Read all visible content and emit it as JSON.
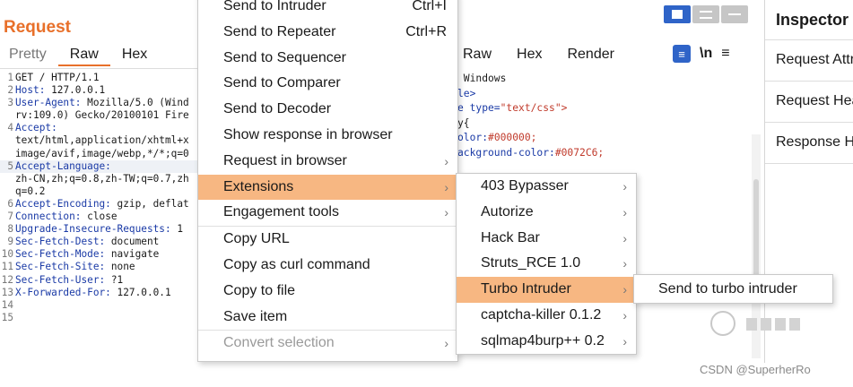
{
  "request": {
    "title": "Request",
    "tabs": [
      "Pretty",
      "Raw",
      "Hex"
    ],
    "lines": [
      {
        "n": "1",
        "key": "",
        "val": "GET / HTTP/1.1"
      },
      {
        "n": "2",
        "key": "Host:",
        "val": " 127.0.0.1"
      },
      {
        "n": "3",
        "key": "User-Agent:",
        "val": " Mozilla/5.0 (Wind"
      },
      {
        "n": "",
        "key": "",
        "val": "rv:109.0) Gecko/20100101 Fire"
      },
      {
        "n": "4",
        "key": "Accept:",
        "val": ""
      },
      {
        "n": "",
        "key": "",
        "val": "text/html,application/xhtml+x"
      },
      {
        "n": "",
        "key": "",
        "val": "image/avif,image/webp,*/*;q=0"
      },
      {
        "n": "5",
        "key": "Accept-Language:",
        "val": ""
      },
      {
        "n": "",
        "key": "",
        "val": "zh-CN,zh;q=0.8,zh-TW;q=0.7,zh"
      },
      {
        "n": "",
        "key": "",
        "val": "q=0.2"
      },
      {
        "n": "6",
        "key": "Accept-Encoding:",
        "val": " gzip, deflat"
      },
      {
        "n": "7",
        "key": "Connection:",
        "val": " close"
      },
      {
        "n": "8",
        "key": "Upgrade-Insecure-Requests:",
        "val": " 1"
      },
      {
        "n": "9",
        "key": "Sec-Fetch-Dest:",
        "val": " document"
      },
      {
        "n": "10",
        "key": "Sec-Fetch-Mode:",
        "val": " navigate"
      },
      {
        "n": "11",
        "key": "Sec-Fetch-Site:",
        "val": " none"
      },
      {
        "n": "12",
        "key": "Sec-Fetch-User:",
        "val": " ?1"
      },
      {
        "n": "13",
        "key": "X-Forwarded-For:",
        "val": " 127.0.0.1"
      },
      {
        "n": "14",
        "key": "",
        "val": ""
      },
      {
        "n": "15",
        "key": "",
        "val": ""
      }
    ]
  },
  "response": {
    "title_visible": "e",
    "tabs": [
      "Raw",
      "Hex",
      "Render"
    ],
    "wrap_icon_label": "\\n",
    "code_lines": [
      {
        "t": "",
        "rest": " Windows"
      },
      {
        "t": "le>",
        "rest": ""
      },
      {
        "t": "e type=",
        "rest": "",
        "s": "\"text/css\">"
      },
      {
        "t": "",
        "rest": "y{"
      },
      {
        "t": "olor:",
        "rest": "",
        "s": "#000000;"
      },
      {
        "t": "ackground-color:",
        "rest": "",
        "s": "#0072C6;"
      }
    ]
  },
  "inspector": {
    "title": "Inspector",
    "rows": [
      "Request Attributes",
      "Request Headers",
      "Response Headers"
    ]
  },
  "context_menu": {
    "items": [
      {
        "label": "Send to Intruder",
        "shortcut": "Ctrl+I"
      },
      {
        "label": "Send to Repeater",
        "shortcut": "Ctrl+R"
      },
      {
        "label": "Send to Sequencer"
      },
      {
        "label": "Send to Comparer"
      },
      {
        "label": "Send to Decoder"
      },
      {
        "label": "Show response in browser"
      },
      {
        "label": "Request in browser",
        "submenu": true
      },
      {
        "label": "Extensions",
        "submenu": true,
        "selected": true
      },
      {
        "label": "Engagement tools",
        "submenu": true
      },
      {
        "label": "Copy URL"
      },
      {
        "label": "Copy as curl command"
      },
      {
        "label": "Copy to file"
      },
      {
        "label": "Save item"
      },
      {
        "label": "Convert selection",
        "submenu": true,
        "disabled": true
      }
    ]
  },
  "extensions_menu": {
    "items": [
      {
        "label": "403 Bypasser"
      },
      {
        "label": "Autorize"
      },
      {
        "label": "Hack Bar"
      },
      {
        "label": "Struts_RCE 1.0"
      },
      {
        "label": "Turbo Intruder",
        "selected": true
      },
      {
        "label": "captcha-killer 0.1.2"
      },
      {
        "label": "sqlmap4burp++ 0.2"
      }
    ]
  },
  "turbo_menu": {
    "items": [
      {
        "label": "Send to turbo intruder"
      }
    ]
  },
  "watermark": {
    "text": "CSDN @SuperherRo"
  },
  "colors": {
    "accent": "#e8702a",
    "selection": "#f7b782",
    "toggle_blue": "#2f64c8"
  }
}
